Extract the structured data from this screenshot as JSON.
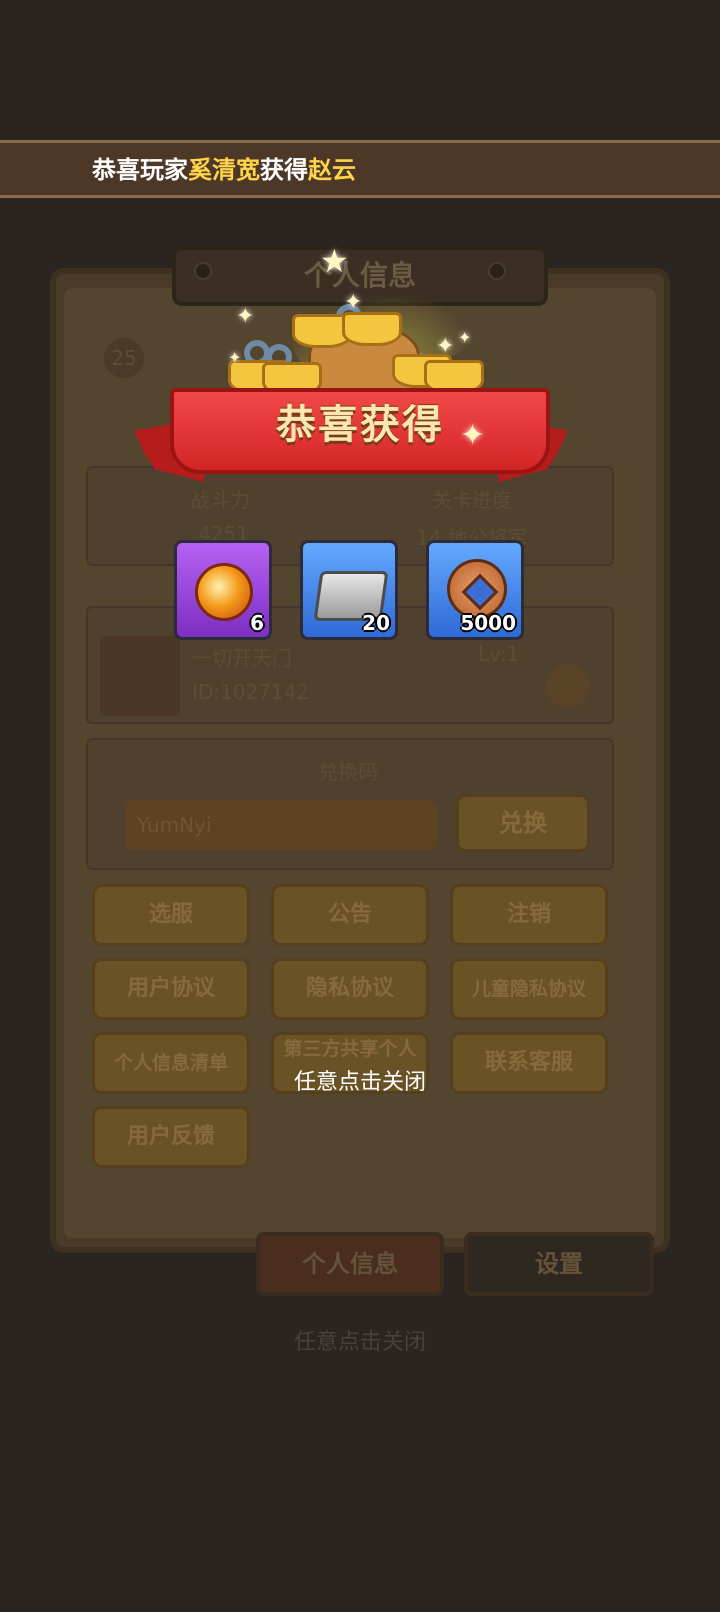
{
  "banner": {
    "prefix": "恭喜玩家",
    "player": "奚清宽",
    "middle": "获得",
    "reward": "赵云"
  },
  "background": {
    "title": "个人信息",
    "level": "25",
    "stats": [
      "战斗力",
      "关卡进度",
      "4251",
      "14 地公将军"
    ],
    "guild_name": "一切开天门",
    "guild_id": "ID:1027142",
    "guild_level": "Lv:1",
    "redeem_label": "兑换码",
    "redeem_placeholder": "YumNyi",
    "redeem_button": "兑换",
    "buttons": [
      "选服",
      "公告",
      "注销",
      "用户协议",
      "隐私协议",
      "儿童隐私协议",
      "个人信息清单",
      "第三方共享个人",
      "联系客服",
      "用户反馈"
    ],
    "tabs": [
      "个人信息",
      "设置"
    ],
    "hint": "任意点击关闭"
  },
  "popup": {
    "title": "恭喜获得",
    "items": [
      {
        "icon": "dragon-orb-icon",
        "count": "6",
        "rarity": "purple"
      },
      {
        "icon": "stone-block-icon",
        "count": "20",
        "rarity": "blue"
      },
      {
        "icon": "copper-coin-icon",
        "count": "5000",
        "rarity": "blue"
      }
    ],
    "close_hint": "任意点击关闭"
  },
  "colors": {
    "highlight": "#ffd34a",
    "ribbon": "#d42525",
    "purple_rarity": "#9a48dc",
    "blue_rarity": "#3f83ea"
  }
}
